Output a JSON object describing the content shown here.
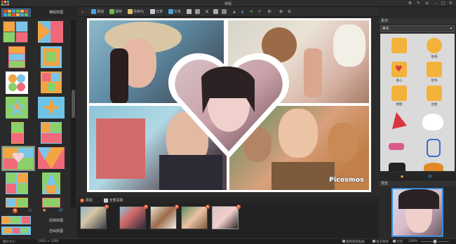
{
  "app": {
    "title": "排版"
  },
  "left_panel": {
    "tab_collage": "横版拼图",
    "lower_tab_portrait": "经典拼图",
    "lower_tab_pose": "自由拼图",
    "layouts": [
      {
        "id": "l1"
      },
      {
        "id": "l2"
      },
      {
        "id": "l3"
      },
      {
        "id": "l4"
      },
      {
        "id": "l5"
      },
      {
        "id": "l6"
      },
      {
        "id": "l7"
      },
      {
        "id": "l8"
      },
      {
        "id": "l9"
      },
      {
        "id": "l10"
      },
      {
        "id": "l11"
      },
      {
        "id": "l12"
      },
      {
        "id": "l13"
      },
      {
        "id": "l14"
      },
      {
        "id": "l15"
      },
      {
        "id": "l16"
      }
    ]
  },
  "toolbar": {
    "add_label": "添加",
    "save_label": "保存",
    "save_as_label": "另存为",
    "share_label": "分享",
    "text_label": "文本"
  },
  "canvas": {
    "watermark": "Picosmos"
  },
  "bottom_bar": {
    "add_label": "添加",
    "clear_label": "全部清除",
    "thumbs_count": 5
  },
  "right_panel": {
    "header": "素材",
    "dropdown_value": "美化",
    "stickers": [
      {
        "label": "",
        "icon": "upload-icon"
      },
      {
        "label": "贴纸",
        "icon": "crown-icon"
      },
      {
        "label": "爱心",
        "icon": "heart-icon"
      },
      {
        "label": "装饰",
        "icon": "crown-icon"
      },
      {
        "label": "相框",
        "icon": "upload-icon"
      },
      {
        "label": "边框",
        "icon": "coin-icon"
      }
    ],
    "preview_header": "预览"
  },
  "status_bar": {
    "size_label": "图片大小",
    "size_value": "1920 × 1200",
    "pin_label": "复制到剪贴板",
    "email_label": "电子邮件",
    "print_label": "打印",
    "zoom_label": "100%"
  },
  "colors": {
    "accent": "#3b8de0",
    "delete_badge": "#e0562a",
    "toolbar_bg": "#2e2e2e",
    "panel_bg": "#2a2a2a"
  }
}
